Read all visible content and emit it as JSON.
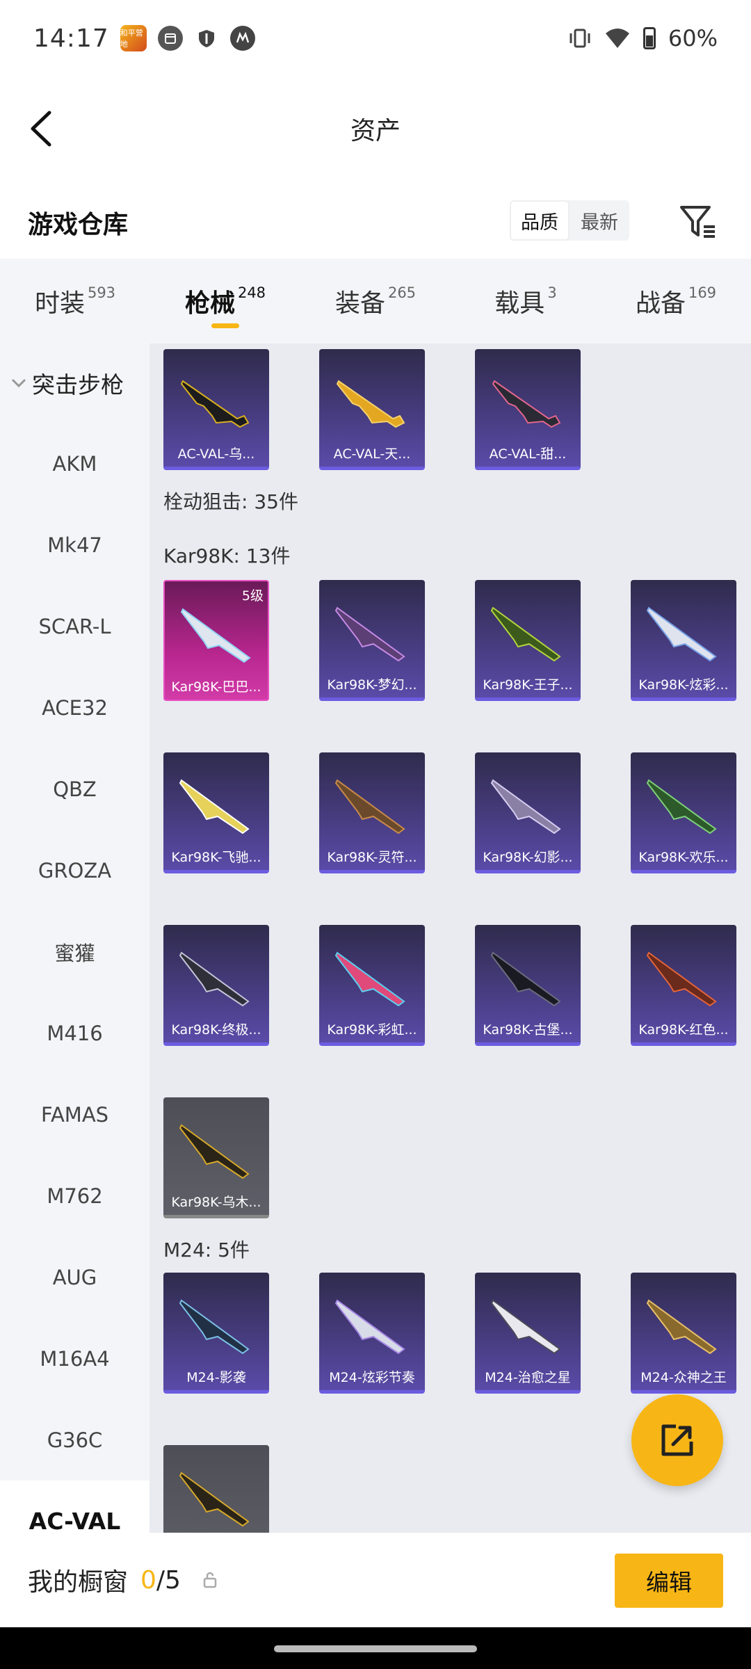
{
  "status_bar": {
    "time": "14:17",
    "app_thumb": "和平营地",
    "battery": "60%",
    "icons": [
      "calendar-icon",
      "shield-icon",
      "motorola-icon",
      "vibrate-icon",
      "wifi-icon",
      "battery-icon"
    ]
  },
  "header": {
    "title": "资产"
  },
  "warehouse": {
    "title": "游戏仓库",
    "sort_options": [
      "品质",
      "最新"
    ],
    "selected_sort": "品质"
  },
  "tabs": [
    {
      "label": "时装",
      "count": "593"
    },
    {
      "label": "枪械",
      "count": "248",
      "active": true
    },
    {
      "label": "装备",
      "count": "265"
    },
    {
      "label": "载具",
      "count": "3"
    },
    {
      "label": "战备",
      "count": "169"
    }
  ],
  "sidebar": {
    "group": "突击步枪",
    "items": [
      "AKM",
      "Mk47",
      "SCAR-L",
      "ACE32",
      "QBZ",
      "GROZA",
      "蜜獾",
      "M416",
      "FAMAS",
      "M762",
      "AUG",
      "M16A4",
      "G36C",
      "AC-VAL"
    ],
    "selected": "AC-VAL"
  },
  "content": {
    "top_row": [
      {
        "name": "AC-VAL-乌..."
      },
      {
        "name": "AC-VAL-天..."
      },
      {
        "name": "AC-VAL-甜..."
      }
    ],
    "section_label": "栓动狙击: 35件",
    "kar_label": "Kar98K: 13件",
    "kar_items": [
      {
        "name": "Kar98K-巴巴...",
        "level": "5级",
        "rarity": "pink"
      },
      {
        "name": "Kar98K-梦幻..."
      },
      {
        "name": "Kar98K-王子..."
      },
      {
        "name": "Kar98K-炫彩..."
      },
      {
        "name": "Kar98K-飞驰..."
      },
      {
        "name": "Kar98K-灵符..."
      },
      {
        "name": "Kar98K-幻影..."
      },
      {
        "name": "Kar98K-欢乐..."
      },
      {
        "name": "Kar98K-终极..."
      },
      {
        "name": "Kar98K-彩虹..."
      },
      {
        "name": "Kar98K-古堡..."
      },
      {
        "name": "Kar98K-红色..."
      },
      {
        "name": "Kar98K-乌木...",
        "rarity": "gray"
      }
    ],
    "m24_label": "M24: 5件",
    "m24_items": [
      {
        "name": "M24-影袭"
      },
      {
        "name": "M24-炫彩节奏"
      },
      {
        "name": "M24-治愈之星"
      },
      {
        "name": "M24-众神之王"
      },
      {
        "name": ""
      }
    ]
  },
  "bottom_bar": {
    "label": "我的橱窗",
    "current": "0",
    "total": "/5",
    "edit_label": "编辑"
  },
  "colors": {
    "accent": "#f8b616",
    "card_purple": "#4b3f88",
    "card_pink": "#b6268d"
  }
}
